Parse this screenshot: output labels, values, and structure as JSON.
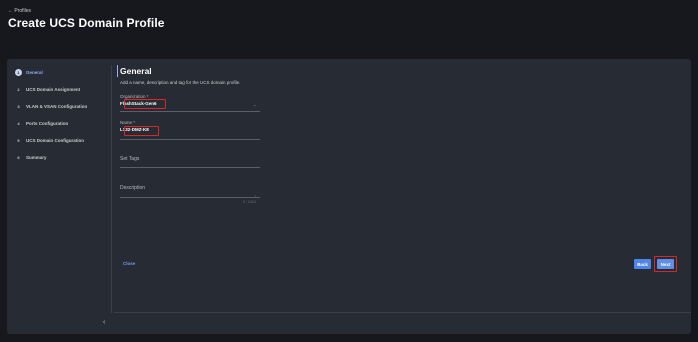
{
  "header": {
    "back_link": "← Profiles",
    "title": "Create UCS Domain Profile"
  },
  "wizard": {
    "steps": [
      {
        "num": "1",
        "label": "General",
        "active": true
      },
      {
        "num": "2",
        "label": "UCS Domain Assignment",
        "active": false
      },
      {
        "num": "3",
        "label": "VLAN & VSAN Configuration",
        "active": false
      },
      {
        "num": "4",
        "label": "Ports Configuration",
        "active": false
      },
      {
        "num": "5",
        "label": "UCS Domain Configuration",
        "active": false
      },
      {
        "num": "6",
        "label": "Summary",
        "active": false
      }
    ],
    "collapse_icon": "chevron-left-icon"
  },
  "general": {
    "title": "General",
    "description": "Add a name, description and tag for the UCS domain profile.",
    "organization": {
      "label": "Organization *",
      "value": "FlashStack-Gen6"
    },
    "name": {
      "label": "Name *",
      "value": "L132-DMZ-K8"
    },
    "tags": {
      "label": "Set Tags"
    },
    "description_field": {
      "label": "Description",
      "counter": "0 / 1024"
    }
  },
  "footer": {
    "close": "Close",
    "back": "Back",
    "next": "Next"
  },
  "colors": {
    "accent": "#8fb0ff",
    "highlight": "#d8262b",
    "primary_button": "#4d86e6"
  }
}
